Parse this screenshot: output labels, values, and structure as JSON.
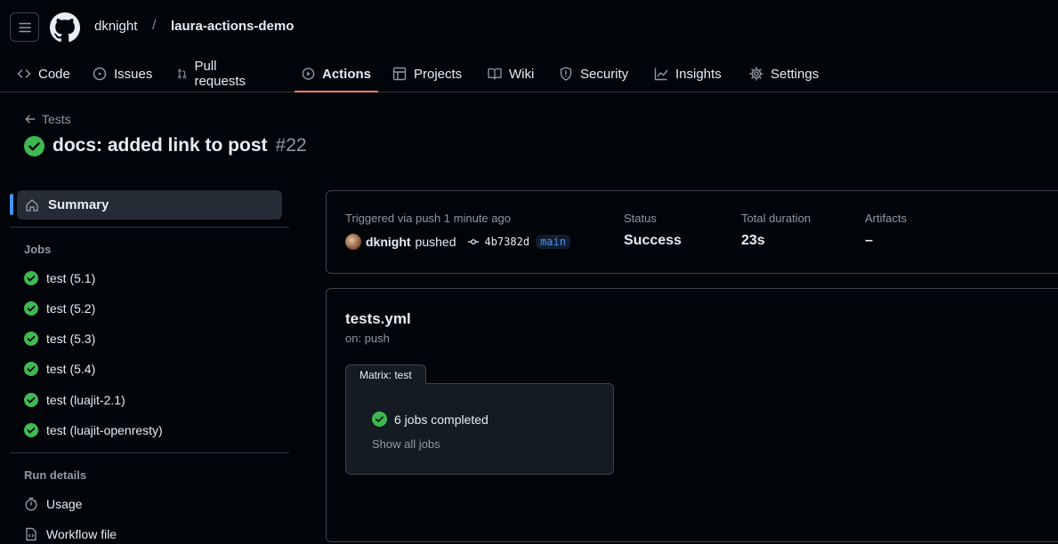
{
  "header": {
    "owner": "dknight",
    "separator": "/",
    "repo": "laura-actions-demo"
  },
  "tabs": [
    {
      "label": "Code",
      "icon": "code-icon"
    },
    {
      "label": "Issues",
      "icon": "issue-icon"
    },
    {
      "label": "Pull requests",
      "icon": "pull-request-icon"
    },
    {
      "label": "Actions",
      "icon": "play-icon",
      "active": true
    },
    {
      "label": "Projects",
      "icon": "table-icon"
    },
    {
      "label": "Wiki",
      "icon": "book-icon"
    },
    {
      "label": "Security",
      "icon": "shield-icon"
    },
    {
      "label": "Insights",
      "icon": "graph-icon"
    },
    {
      "label": "Settings",
      "icon": "gear-icon"
    }
  ],
  "run": {
    "back_label": "Tests",
    "title": "docs: added link to post",
    "number": "#22"
  },
  "sidebar": {
    "summary_label": "Summary",
    "jobs_heading": "Jobs",
    "jobs": [
      {
        "label": "test (5.1)"
      },
      {
        "label": "test (5.2)"
      },
      {
        "label": "test (5.3)"
      },
      {
        "label": "test (5.4)"
      },
      {
        "label": "test (luajit-2.1)"
      },
      {
        "label": "test (luajit-openresty)"
      }
    ],
    "run_details_heading": "Run details",
    "usage_label": "Usage",
    "workflow_file_label": "Workflow file"
  },
  "summary": {
    "triggered": "Triggered via push 1 minute ago",
    "user": "dknight",
    "action": "pushed",
    "sha": "4b7382d",
    "branch": "main",
    "status_label": "Status",
    "status_value": "Success",
    "duration_label": "Total duration",
    "duration_value": "23s",
    "artifacts_label": "Artifacts",
    "artifacts_value": "–"
  },
  "workflow": {
    "name": "tests.yml",
    "trigger": "on: push",
    "matrix_label": "Matrix: test",
    "jobs_completed": "6 jobs completed",
    "show_all": "Show all jobs"
  },
  "colors": {
    "success": "#3fb950",
    "accent_underline": "#f78166",
    "link_blue": "#4493f8"
  }
}
